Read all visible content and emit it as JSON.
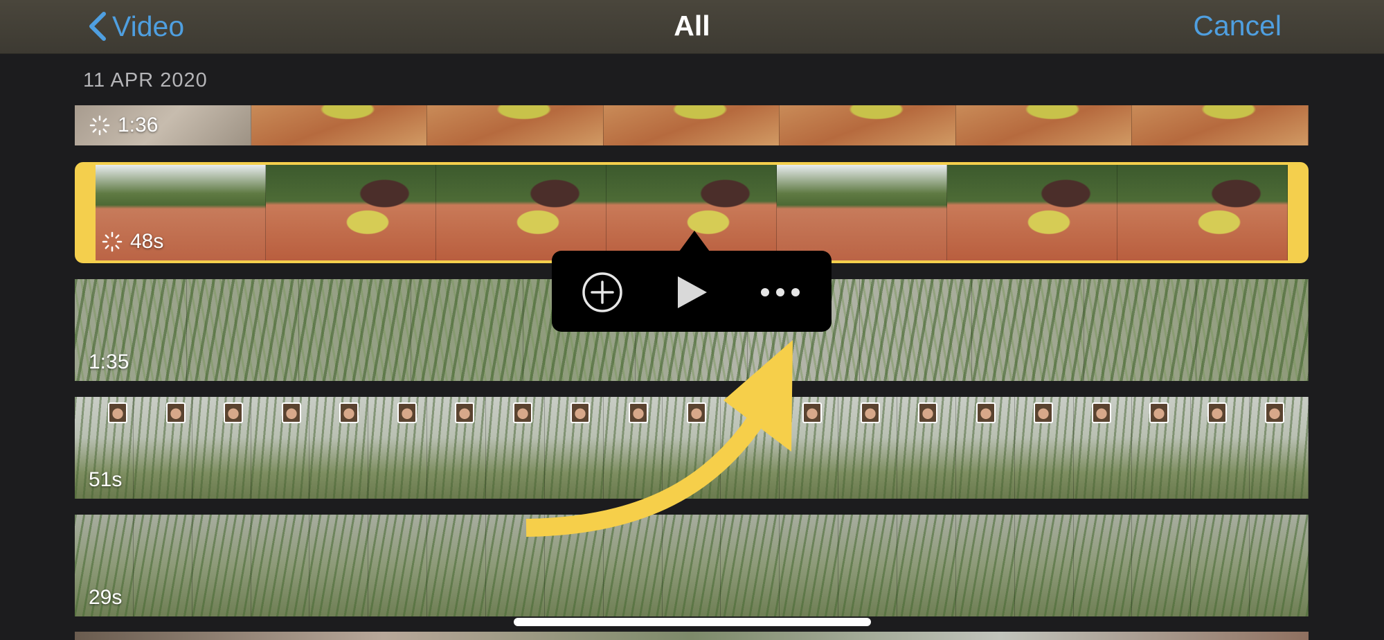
{
  "nav": {
    "back_label": "Video",
    "title": "All",
    "cancel_label": "Cancel"
  },
  "date_header": "11 APR 2020",
  "clips": [
    {
      "duration": "1:36",
      "loading": true
    },
    {
      "duration": "48s",
      "loading": true,
      "selected": true
    },
    {
      "duration": "1:35",
      "loading": false
    },
    {
      "duration": "51s",
      "loading": false
    },
    {
      "duration": "29s",
      "loading": false
    }
  ],
  "popup": {
    "icons": [
      "add-circle-icon",
      "play-icon",
      "more-icon"
    ]
  },
  "colors": {
    "accent_blue": "#4f9fe0",
    "selection_yellow": "#f4cf4d",
    "annotation_arrow": "#f6cf4a",
    "background": "#1c1c1e"
  }
}
